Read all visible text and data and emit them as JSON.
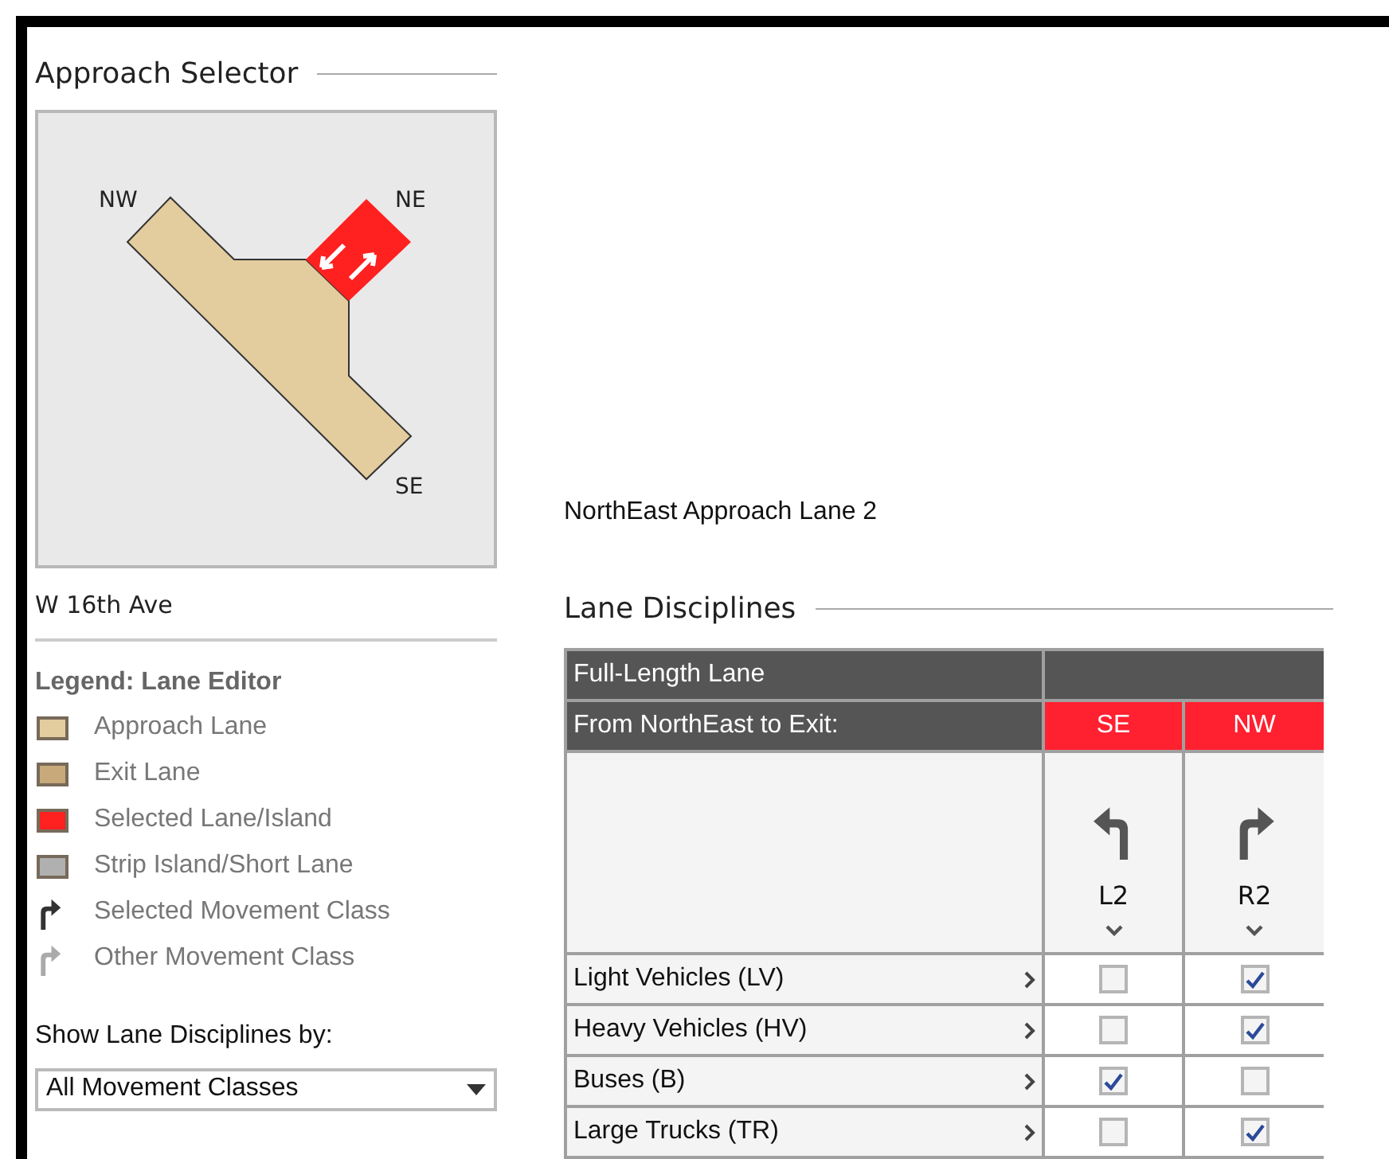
{
  "approach_selector": {
    "title": "Approach Selector",
    "compass": [
      "NW",
      "NE",
      "SE"
    ],
    "street": "W 16th Ave"
  },
  "legend": {
    "title": "Legend: Lane Editor",
    "items": [
      {
        "kind": "swatch",
        "color": "#e3cc9e",
        "label": "Approach Lane"
      },
      {
        "kind": "swatch",
        "color": "#c8a97a",
        "label": "Exit Lane"
      },
      {
        "kind": "swatch",
        "color": "#ff2020",
        "label": "Selected Lane/Island"
      },
      {
        "kind": "swatch",
        "color": "#b0b0b0",
        "label": "Strip Island/Short Lane"
      },
      {
        "kind": "arrow",
        "color": "#333333",
        "label": "Selected Movement Class"
      },
      {
        "kind": "arrow",
        "color": "#aaaaaa",
        "label": "Other Movement Class"
      }
    ]
  },
  "show_by": {
    "label": "Show Lane Disciplines by:",
    "value": "All Movement Classes"
  },
  "lane_name": "NorthEast Approach Lane 2",
  "lane_disciplines": {
    "title": "Lane Disciplines",
    "header": "Full-Length Lane",
    "exit_label": "From NorthEast to Exit:",
    "exits": [
      {
        "label": "SE",
        "movement": "L2",
        "kind": "left"
      },
      {
        "label": "NW",
        "movement": "R2",
        "kind": "right"
      }
    ],
    "rows": [
      {
        "label": "Light Vehicles (LV)",
        "checks": [
          false,
          true
        ]
      },
      {
        "label": "Heavy Vehicles (HV)",
        "checks": [
          false,
          true
        ]
      },
      {
        "label": "Buses (B)",
        "checks": [
          true,
          false
        ]
      },
      {
        "label": "Large Trucks (TR)",
        "checks": [
          false,
          true
        ]
      }
    ]
  }
}
